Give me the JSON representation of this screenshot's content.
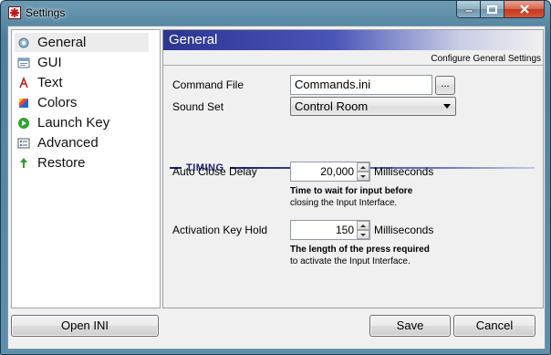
{
  "window": {
    "title": "Settings"
  },
  "sidebar": {
    "items": [
      {
        "label": "General",
        "icon": "general-icon",
        "selected": true
      },
      {
        "label": "GUI",
        "icon": "gui-icon",
        "selected": false
      },
      {
        "label": "Text",
        "icon": "text-icon",
        "selected": false
      },
      {
        "label": "Colors",
        "icon": "colors-icon",
        "selected": false
      },
      {
        "label": "Launch Key",
        "icon": "launch-key-icon",
        "selected": false
      },
      {
        "label": "Advanced",
        "icon": "advanced-icon",
        "selected": false
      },
      {
        "label": "Restore",
        "icon": "restore-icon",
        "selected": false
      }
    ]
  },
  "main": {
    "title": "General",
    "subtitle": "Configure General Settings",
    "command_file": {
      "label": "Command File",
      "value": "Commands.ini",
      "browse_label": "..."
    },
    "sound_set": {
      "label": "Sound Set",
      "value": "Control Room"
    },
    "timing": {
      "heading": "TIMING",
      "auto_close": {
        "label": "Auto Close Delay",
        "value": "20,000",
        "unit": "Milliseconds",
        "hint_bold": "Time to wait for input before",
        "hint": "closing the Input Interface."
      },
      "activation_hold": {
        "label": "Activation Key Hold",
        "value": "150",
        "unit": "Milliseconds",
        "hint_bold": "The length of the press required",
        "hint": "to activate the Input Interface."
      }
    }
  },
  "buttons": {
    "open_ini": "Open INI",
    "save": "Save",
    "cancel": "Cancel"
  },
  "colors": {
    "header_band": "#2c3591",
    "section_accent": "#1a1f7a",
    "close_button": "#c2381d"
  }
}
